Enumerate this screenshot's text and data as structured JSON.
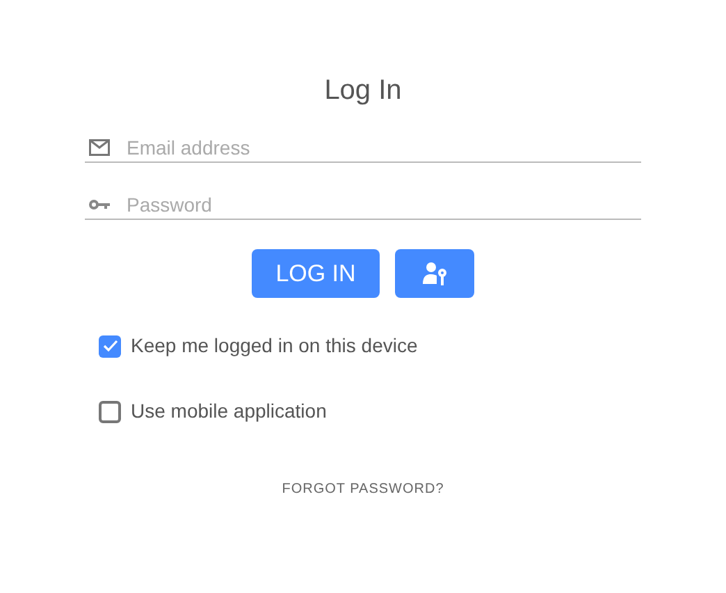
{
  "title": "Log In",
  "fields": [
    {
      "kind": "email",
      "placeholder": "Email address"
    },
    {
      "kind": "password",
      "placeholder": "Password"
    }
  ],
  "login_button": "LOG IN",
  "options": [
    {
      "label": "Keep me logged in on this device",
      "checked": true
    },
    {
      "label": "Use mobile application",
      "checked": false
    }
  ],
  "forgot_link": "FORGOT PASSWORD?"
}
